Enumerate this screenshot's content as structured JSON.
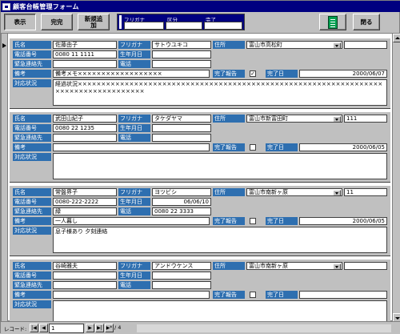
{
  "window": {
    "title": "顧客台帳管理フォーム"
  },
  "toolbar": {
    "view_label": "表示",
    "complete_label": "完完",
    "new_label": "新規追加",
    "close_label": "閉る",
    "filter_labels": {
      "name": "フリガナ",
      "category": "区分",
      "status": "完了"
    }
  },
  "labels": {
    "name": "氏名",
    "phone": "電話番号",
    "emergency": "緊急連絡先",
    "note": "備考",
    "progress": "対応状況",
    "furigana": "フリガナ",
    "birth": "生年月日",
    "mobile": "電話",
    "address": "住所",
    "done": "完了報告",
    "date": "完了日"
  },
  "records": [
    {
      "name": "佐藤由子",
      "furigana": "サトウユキコ",
      "address": "富山市高松町",
      "address2": "",
      "phone": "0080 11 1111",
      "birth": "",
      "emergency": "",
      "mobile": "",
      "note": "備考メモ××××××××××××××××××",
      "checked": true,
      "date": "2000/06/07",
      "progress": "経過状況××××××××××××××××××××××××××××××××××××××××××××××××××××××××××××××××××××××××××××××××××××"
    },
    {
      "name": "武田山紀子",
      "furigana": "タケダヤマ",
      "address": "富山市新富田町",
      "address2": "111",
      "phone": "0080 22 1235",
      "birth": "",
      "emergency": "",
      "mobile": "",
      "note": "",
      "checked": false,
      "date": "2000/06/05",
      "progress": ""
    },
    {
      "name": "常盤界子",
      "furigana": "ヨツビシ",
      "address": "富山市南新ヶ原",
      "address2": "11",
      "phone": "0080-222-2222",
      "birth": "06/06/10",
      "emergency": "緑",
      "mobile": "0080 22 3333",
      "note": "一人暮し",
      "checked": false,
      "date": "2000/06/05",
      "progress": "息子様あり 夕刻連絡"
    },
    {
      "name": "谷崎雅夫",
      "furigana": "アンドウケンス",
      "address": "富山市南新ヶ原",
      "address2": "",
      "phone": "",
      "birth": "",
      "emergency": "",
      "mobile": "",
      "note": "",
      "checked": false,
      "date": "",
      "progress": ""
    }
  ],
  "nav": {
    "record_label": "レコード:",
    "current": "1",
    "total_label": "/ 4"
  },
  "icons": {
    "first": "first-record-icon",
    "prev": "prev-record-icon",
    "next": "next-record-icon",
    "last": "last-record-icon",
    "new": "new-record-icon"
  }
}
